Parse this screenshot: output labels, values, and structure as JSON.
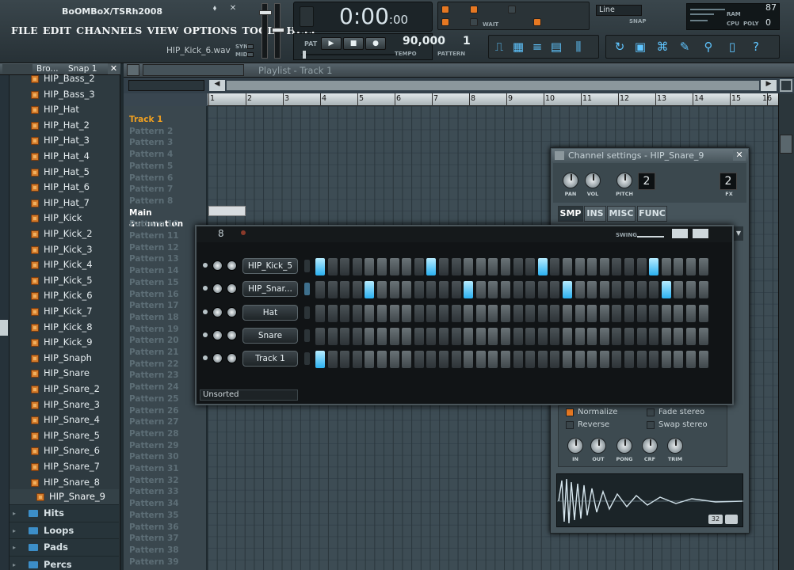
{
  "app": {
    "title": "BoOMBoX/TSRh2008",
    "hint_file": "HIP_Kick_6.wav",
    "menu": [
      "FILE",
      "EDIT",
      "CHANNELS",
      "VIEW",
      "OPTIONS",
      "TOOLS",
      "HELP"
    ]
  },
  "transport": {
    "time": "0:00",
    "time_frac": ":00",
    "pat_label": "PAT",
    "tempo_value": "90,000",
    "tempo_label": "TEMPO",
    "pattern_value": "1",
    "pattern_label": "PATTERN",
    "snap_mode": "Line",
    "snap_label": "SNAP",
    "wait_label": "WAIT",
    "syn_label": "SYN",
    "mid_label": "MID"
  },
  "monitor": {
    "ram_label": "RAM",
    "ram_value": "87",
    "cpu_label": "CPU",
    "poly_label": "POLY",
    "poly_value": "0"
  },
  "browser": {
    "header": "Bro...",
    "snap": "Snap 1",
    "items": [
      "HIP_Bass_2",
      "HIP_Bass_3",
      "HIP_Hat",
      "HIP_Hat_2",
      "HIP_Hat_3",
      "HIP_Hat_4",
      "HIP_Hat_5",
      "HIP_Hat_6",
      "HIP_Hat_7",
      "HIP_Kick",
      "HIP_Kick_2",
      "HIP_Kick_3",
      "HIP_Kick_4",
      "HIP_Kick_5",
      "HIP_Kick_6",
      "HIP_Kick_7",
      "HIP_Kick_8",
      "HIP_Kick_9",
      "HIP_Snaph",
      "HIP_Snare",
      "HIP_Snare_2",
      "HIP_Snare_3",
      "HIP_Snare_4",
      "HIP_Snare_5",
      "HIP_Snare_6",
      "HIP_Snare_7",
      "HIP_Snare_8"
    ],
    "selected_item": "HIP_Snare_9",
    "folders": [
      "Hits",
      "Loops",
      "Pads",
      "Percs"
    ]
  },
  "playlist": {
    "title": "Playlist - Track 1",
    "bars": [
      "1",
      "2",
      "3",
      "4",
      "5",
      "6",
      "7",
      "8",
      "9",
      "10",
      "11",
      "12",
      "13",
      "14",
      "15",
      "16"
    ],
    "rows": [
      "Track 1",
      "Pattern 2",
      "Pattern 3",
      "Pattern 4",
      "Pattern 5",
      "Pattern 6",
      "Pattern 7",
      "Pattern 8",
      "Main automation",
      "Pattern 10",
      "Pattern 11",
      "Pattern 12",
      "Pattern 13",
      "Pattern 14",
      "Pattern 15",
      "Pattern 16",
      "Pattern 17",
      "Pattern 18",
      "Pattern 19",
      "Pattern 20",
      "Pattern 21",
      "Pattern 22",
      "Pattern 23",
      "Pattern 24",
      "Pattern 25",
      "Pattern 26",
      "Pattern 27",
      "Pattern 28",
      "Pattern 29",
      "Pattern 30",
      "Pattern 31",
      "Pattern 32",
      "Pattern 33",
      "Pattern 34",
      "Pattern 35",
      "Pattern 36",
      "Pattern 37",
      "Pattern 38",
      "Pattern 39"
    ]
  },
  "channel_settings": {
    "title": "Channel settings - HIP_Snare_9",
    "knob_labels": [
      "PAN",
      "VOL",
      "PITCH"
    ],
    "channel_number": "2",
    "fx_number": "2",
    "fx_label": "FX",
    "tabs": [
      "SMP",
      "INS",
      "MISC",
      "FUNC"
    ],
    "active_tab": "SMP",
    "options": [
      {
        "label": "Normalize",
        "checked": true
      },
      {
        "label": "Fade stereo",
        "checked": false
      },
      {
        "label": "Reverse",
        "checked": false
      },
      {
        "label": "Swap stereo",
        "checked": false
      }
    ],
    "env_knobs": [
      "IN",
      "OUT",
      "PONG",
      "CRF",
      "TRIM"
    ],
    "wave_badge": "32"
  },
  "step_sequencer": {
    "counter": "8",
    "swing_label": "SWING",
    "filter": "Unsorted",
    "channels": [
      {
        "name": "HIP_Kick_5",
        "steps": [
          1,
          0,
          0,
          0,
          0,
          0,
          0,
          0,
          0,
          1,
          0,
          0,
          0,
          0,
          0,
          0,
          0,
          0,
          1,
          0,
          0,
          0,
          0,
          0,
          0,
          0,
          0,
          1,
          0,
          0,
          0,
          0
        ]
      },
      {
        "name": "HIP_Snar...",
        "steps": [
          0,
          0,
          0,
          0,
          1,
          0,
          0,
          0,
          0,
          0,
          0,
          0,
          1,
          0,
          0,
          0,
          0,
          0,
          0,
          0,
          1,
          0,
          0,
          0,
          0,
          0,
          0,
          0,
          1,
          0,
          0,
          0
        ]
      },
      {
        "name": "Hat",
        "steps": [
          0,
          0,
          0,
          0,
          0,
          0,
          0,
          0,
          0,
          0,
          0,
          0,
          0,
          0,
          0,
          0,
          0,
          0,
          0,
          0,
          0,
          0,
          0,
          0,
          0,
          0,
          0,
          0,
          0,
          0,
          0,
          0
        ]
      },
      {
        "name": "Snare",
        "steps": [
          0,
          0,
          0,
          0,
          0,
          0,
          0,
          0,
          0,
          0,
          0,
          0,
          0,
          0,
          0,
          0,
          0,
          0,
          0,
          0,
          0,
          0,
          0,
          0,
          0,
          0,
          0,
          0,
          0,
          0,
          0,
          0
        ]
      },
      {
        "name": "Track 1",
        "steps": [
          1,
          0,
          0,
          0,
          0,
          0,
          0,
          0,
          0,
          0,
          0,
          0,
          0,
          0,
          0,
          0,
          0,
          0,
          0,
          0,
          0,
          0,
          0,
          0,
          0,
          0,
          0,
          0,
          0,
          0,
          0,
          0
        ]
      }
    ]
  }
}
